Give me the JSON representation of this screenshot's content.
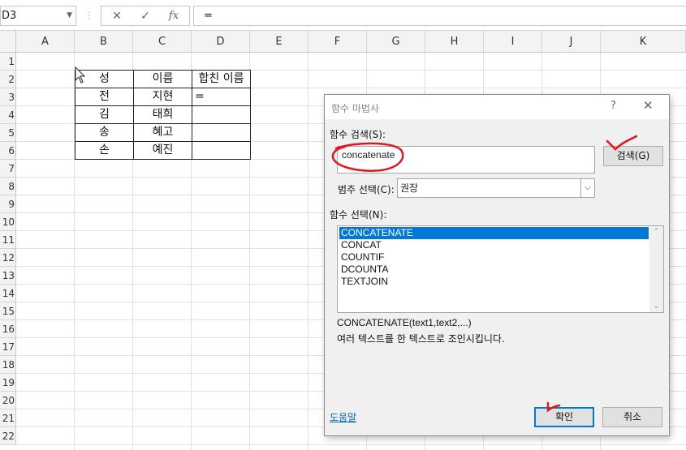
{
  "formula_bar": {
    "name_box": "D3",
    "cancel_icon": "✕",
    "enter_icon": "✓",
    "fx_label": "fx",
    "formula": "="
  },
  "columns": [
    "A",
    "B",
    "C",
    "D",
    "E",
    "F",
    "G",
    "H",
    "I",
    "J",
    "K"
  ],
  "rows": [
    "1",
    "2",
    "3",
    "4",
    "5",
    "6",
    "7",
    "8",
    "9",
    "10",
    "11",
    "12",
    "13",
    "14",
    "15",
    "16",
    "17",
    "18",
    "19",
    "20",
    "21",
    "22"
  ],
  "table": {
    "headers": [
      "성",
      "이름",
      "합친 이름"
    ],
    "rows": [
      [
        "전",
        "지현",
        "="
      ],
      [
        "김",
        "태희",
        ""
      ],
      [
        "송",
        "혜고",
        ""
      ],
      [
        "손",
        "예진",
        ""
      ]
    ]
  },
  "dialog": {
    "title": "함수 마법사",
    "help_glyph": "?",
    "close_glyph": "✕",
    "search_label": "함수 검색(S):",
    "search_value": "concatenate",
    "search_button": "검색(G)",
    "category_label": "범주 선택(C):",
    "category_value": "권장",
    "function_label": "함수 선택(N):",
    "functions": [
      "CONCATENATE",
      "CONCAT",
      "COUNTIF",
      "DCOUNTA",
      "TEXTJOIN"
    ],
    "selected_function": "CONCATENATE",
    "syntax": "CONCATENATE(text1,text2,...)",
    "description": "여러 텍스트를 한 텍스트로 조인시킵니다.",
    "help_link": "도움말",
    "ok_button": "확인",
    "cancel_button": "취소"
  },
  "colors": {
    "selection": "#0078d7",
    "annotation": "#e8141c"
  }
}
